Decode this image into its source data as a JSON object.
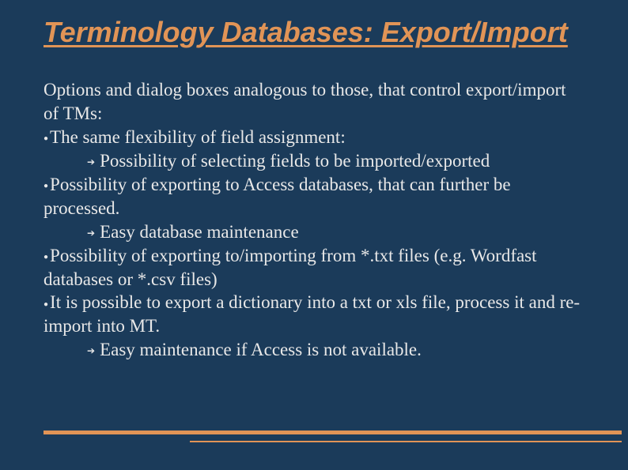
{
  "title": "Terminology Databases: Export/Import",
  "intro": "Options and dialog boxes analogous to those, that control export/import of TMs:",
  "b1": "The same flexibility of field assignment:",
  "s1": "Possibility of selecting fields to be imported/exported",
  "b2": "Possibility of exporting to Access databases, that can further be processed.",
  "s2": "Easy database maintenance",
  "b3": "Possibility of exporting to/importing from *.txt files (e.g. Wordfast databases or *.csv files)",
  "b4": "It is possible to export a dictionary into a txt or xls file, process it and re-import into MT.",
  "s4": "Easy maintenance if Access is not available."
}
